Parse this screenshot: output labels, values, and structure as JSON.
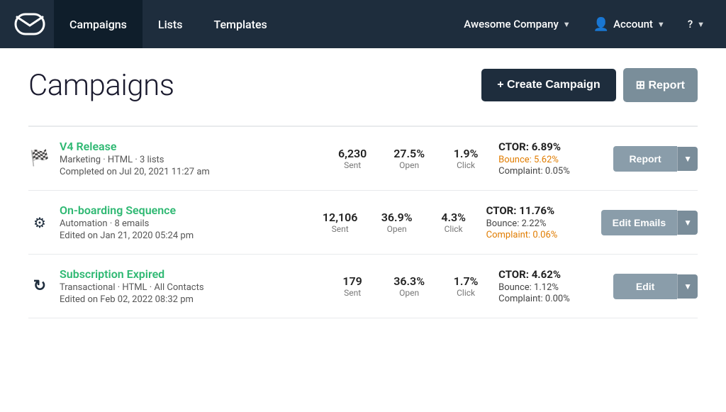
{
  "nav": {
    "logo_alt": "Mail Logo",
    "items": [
      {
        "id": "campaigns",
        "label": "Campaigns",
        "active": true
      },
      {
        "id": "lists",
        "label": "Lists",
        "active": false
      },
      {
        "id": "templates",
        "label": "Templates",
        "active": false
      }
    ],
    "company": {
      "label": "Awesome Company"
    },
    "account": {
      "label": "Account"
    },
    "help": {
      "label": "?"
    }
  },
  "page": {
    "title": "Campaigns",
    "create_btn": "+ Create Campaign",
    "report_btn": "⊞ Report"
  },
  "campaigns": [
    {
      "id": "v4-release",
      "icon": "🏁",
      "icon_name": "flag-icon",
      "name": "V4 Release",
      "meta": "Marketing · HTML · 3 lists",
      "status_label": "Completed",
      "status_date": "on Jul 20, 2021 11:27 am",
      "sent": "6,230",
      "open": "27.5%",
      "click": "1.9%",
      "ctor": "CTOR: 6.89%",
      "bounce": "Bounce: 5.62%",
      "bounce_orange": true,
      "complaint": "Complaint: 0.05%",
      "complaint_orange": false,
      "action_label": "Report"
    },
    {
      "id": "onboarding",
      "icon": "⚙",
      "icon_name": "gear-icon",
      "name": "On-boarding Sequence",
      "meta": "Automation · 8 emails",
      "status_label": "Edited",
      "status_date": "on Jan 21, 2020 05:24 pm",
      "sent": "12,106",
      "open": "36.9%",
      "click": "4.3%",
      "ctor": "CTOR: 11.76%",
      "bounce": "Bounce: 2.22%",
      "bounce_orange": false,
      "complaint": "Complaint: 0.06%",
      "complaint_orange": true,
      "action_label": "Edit Emails"
    },
    {
      "id": "subscription-expired",
      "icon": "↻",
      "icon_name": "refresh-icon",
      "name": "Subscription Expired",
      "meta": "Transactional · HTML · All Contacts",
      "status_label": "Edited",
      "status_date": "on Feb 02, 2022 08:32 pm",
      "sent": "179",
      "open": "36.3%",
      "click": "1.7%",
      "ctor": "CTOR: 4.62%",
      "bounce": "Bounce: 1.12%",
      "bounce_orange": false,
      "complaint": "Complaint: 0.00%",
      "complaint_orange": false,
      "action_label": "Edit"
    }
  ],
  "labels": {
    "sent": "Sent",
    "open": "Open",
    "click": "Click"
  }
}
